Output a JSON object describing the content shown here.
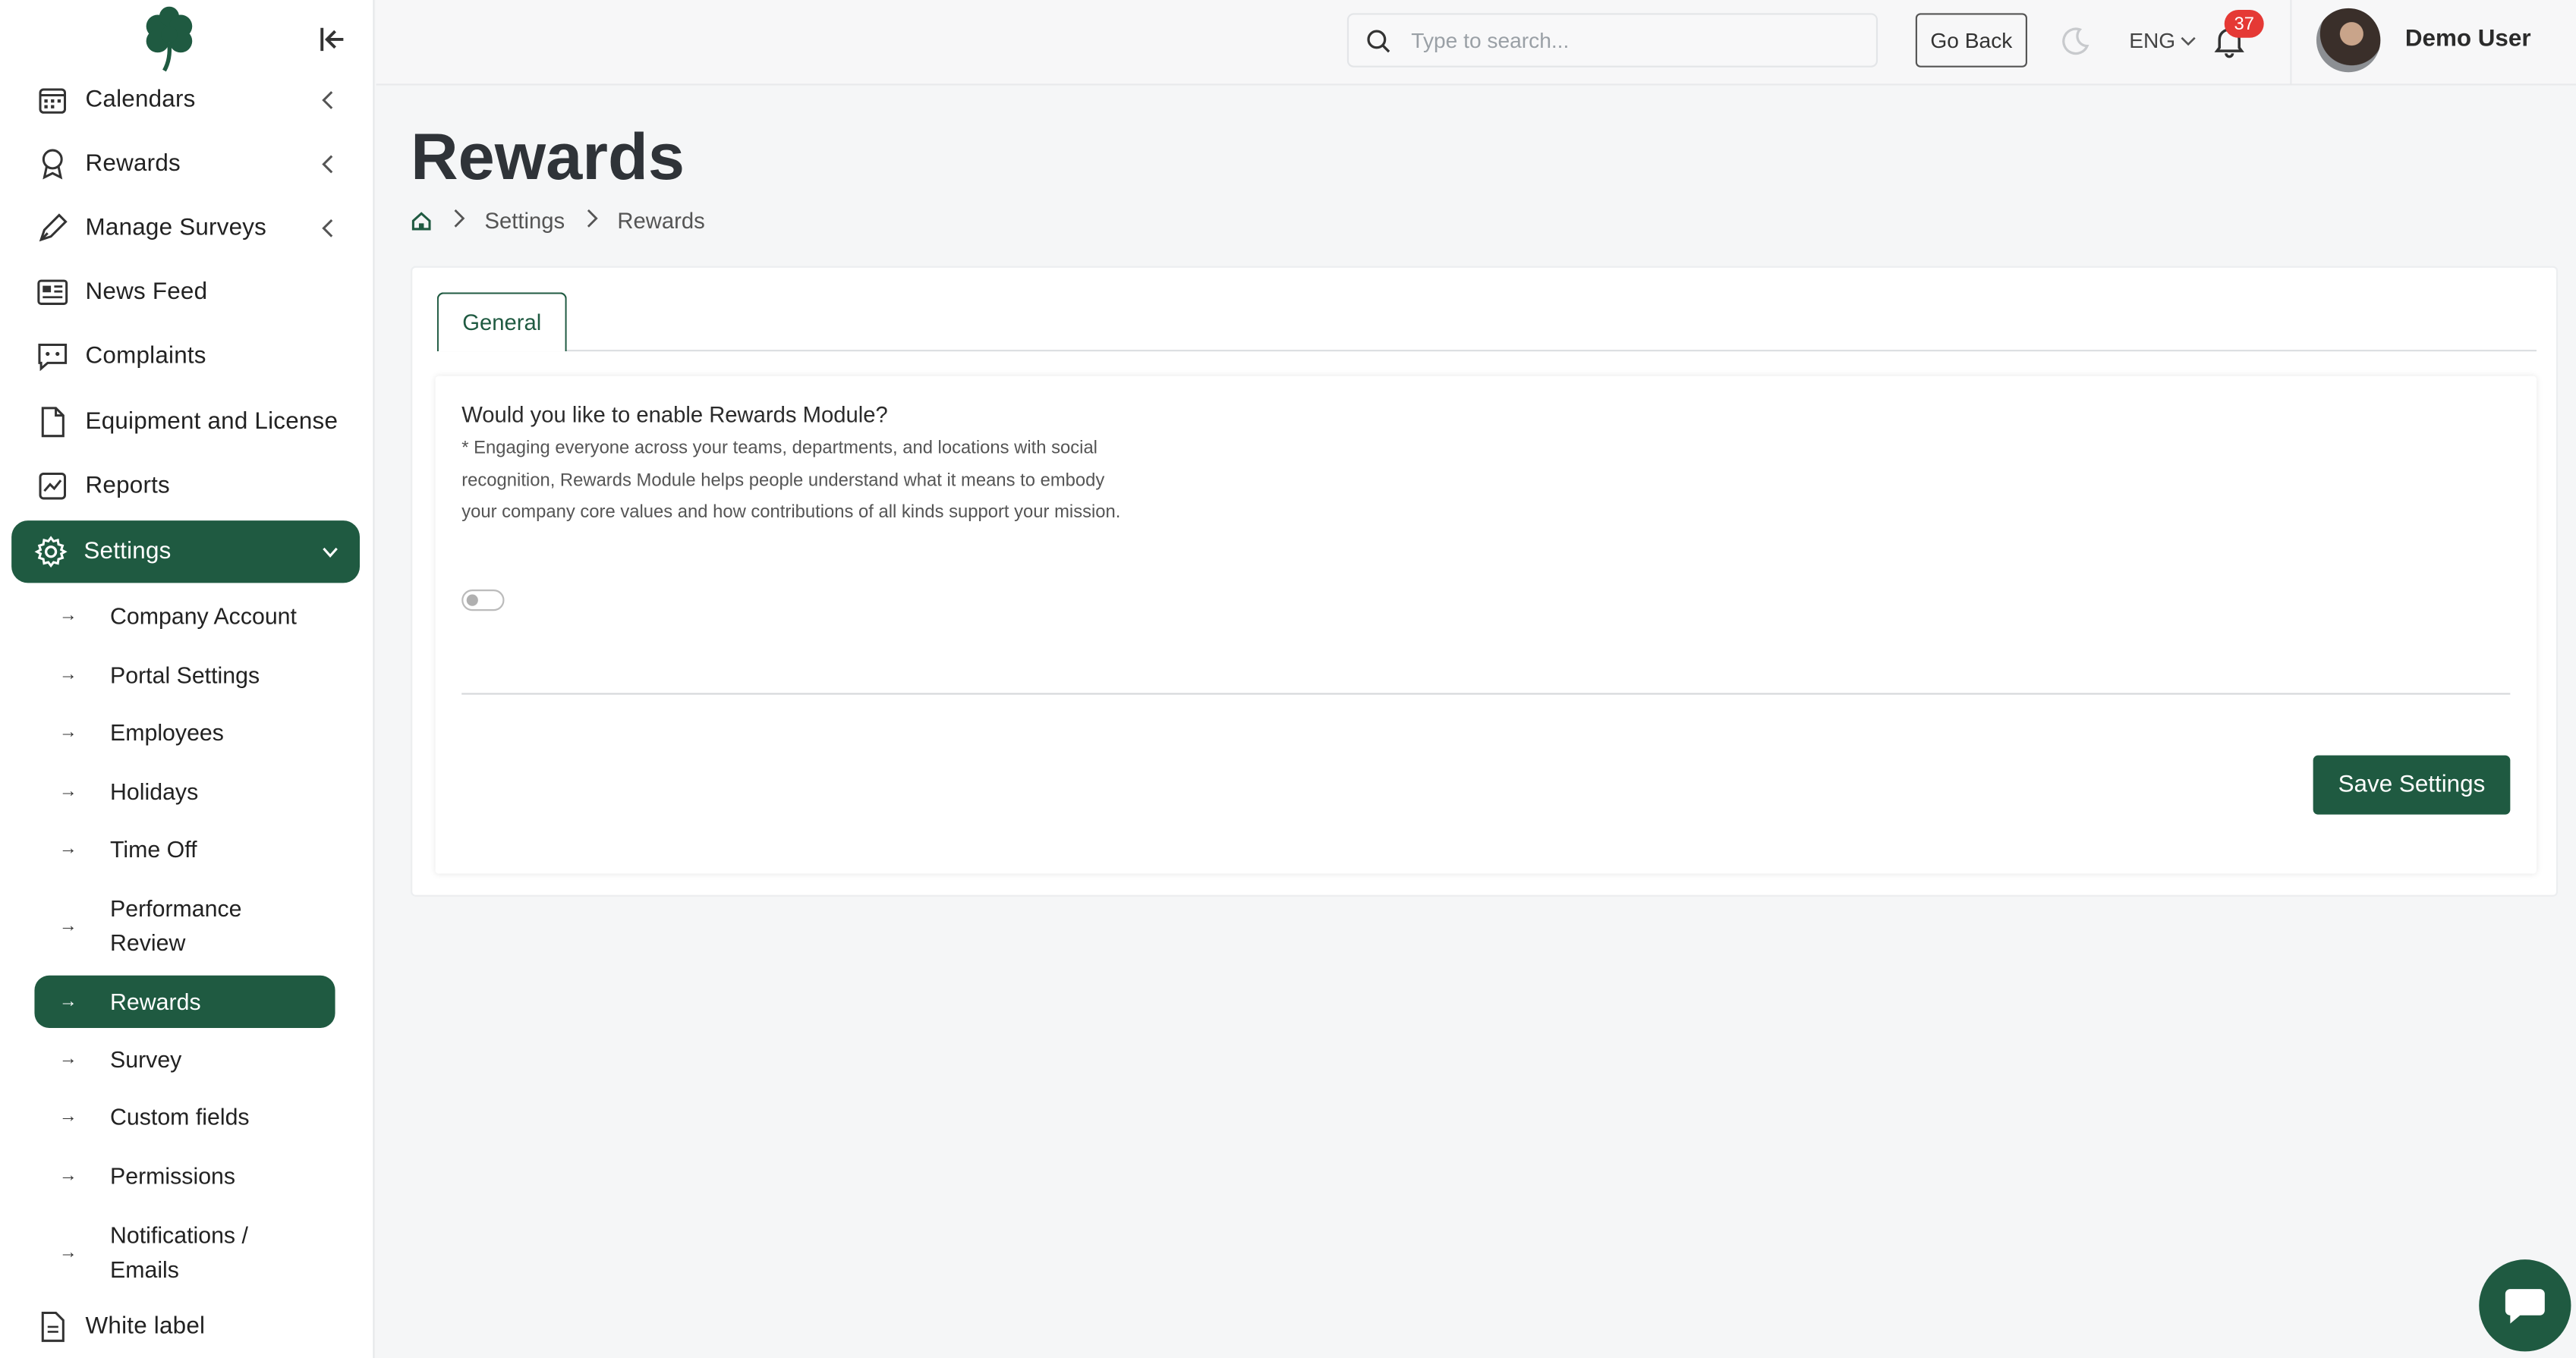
{
  "sidebar": {
    "items": [
      {
        "label": "Calendars",
        "icon": "calendar-icon",
        "has_chevron": true
      },
      {
        "label": "Rewards",
        "icon": "award-icon",
        "has_chevron": true
      },
      {
        "label": "Manage Surveys",
        "icon": "pen-icon",
        "has_chevron": true
      },
      {
        "label": "News Feed",
        "icon": "newspaper-icon"
      },
      {
        "label": "Complaints",
        "icon": "chat-icon"
      },
      {
        "label": "Equipment and License",
        "icon": "document-icon"
      },
      {
        "label": "Reports",
        "icon": "chart-icon"
      },
      {
        "label": "Settings",
        "icon": "gear-icon",
        "active": true
      }
    ],
    "settings_sub": [
      {
        "label": "Company Account"
      },
      {
        "label": "Portal Settings"
      },
      {
        "label": "Employees"
      },
      {
        "label": "Holidays"
      },
      {
        "label": "Time Off"
      },
      {
        "label": "Performance Review"
      },
      {
        "label": "Rewards",
        "active": true
      },
      {
        "label": "Survey"
      },
      {
        "label": "Custom fields"
      },
      {
        "label": "Permissions"
      },
      {
        "label": "Notifications / Emails"
      }
    ],
    "bottom_item": {
      "label": "White label",
      "icon": "document-icon"
    }
  },
  "topbar": {
    "search_placeholder": "Type to search...",
    "go_back": "Go Back",
    "language": "ENG",
    "notifications_count": "37",
    "user_name": "Demo User"
  },
  "page": {
    "title": "Rewards",
    "breadcrumb": [
      "Settings",
      "Rewards"
    ]
  },
  "settings": {
    "tab": "General",
    "question": "Would you like to enable Rewards Module?",
    "description": "* Engaging everyone across your teams, departments, and locations with social recognition, Rewards Module helps people understand what it means to embody your company core values and how contributions of all kinds support your mission.",
    "enabled": false,
    "save_label": "Save Settings"
  },
  "colors": {
    "brand": "#1f5a41",
    "badge": "#e53935"
  }
}
